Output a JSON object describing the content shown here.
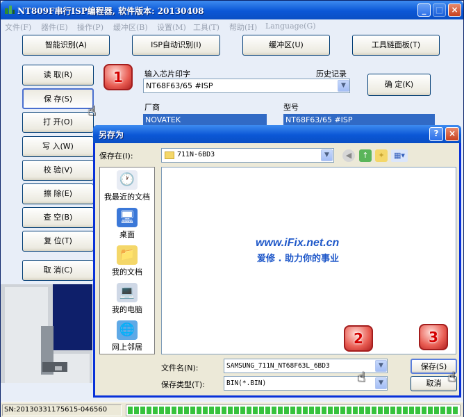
{
  "window": {
    "title": "NT809F串行ISP编程器, 软件版本: 20130408",
    "controls": {
      "minimize": "_",
      "maximize": "□",
      "close": "×"
    }
  },
  "menu": [
    "文件(F)",
    "器件(E)",
    "操作(P)",
    "缓冲区(B)",
    "设置(M)",
    "工具(T)",
    "帮助(H)",
    "Language(G)"
  ],
  "top_buttons": [
    "智能识别(A)",
    "ISP自动识别(I)",
    "缓冲区(U)",
    "工具链面板(T)"
  ],
  "side_buttons": [
    "读 取(R)",
    "保 存(S)",
    "打 开(O)",
    "写 入(W)",
    "校 验(V)",
    "擦 除(E)",
    "查 空(B)",
    "复 位(T)",
    "取 消(C)"
  ],
  "chip": {
    "input_label": "输入芯片印字",
    "history_label": "历史记录",
    "value": "NT68F63/65 #ISP",
    "confirm": "确 定(K)",
    "vendor_label": "厂商",
    "vendor": "NOVATEK",
    "model_label": "型号",
    "model": "NT68F63/65 #ISP"
  },
  "status": {
    "serial": "SN:20130331175615-046560",
    "progress": 1.0
  },
  "dialog": {
    "title": "另存为",
    "help": "?",
    "close": "×",
    "save_in_label": "保存在(I):",
    "save_in_value": "711N-6BD3",
    "places": [
      "我最近的文档",
      "桌面",
      "我的文档",
      "我的电脑",
      "网上邻居"
    ],
    "filename_label": "文件名(N):",
    "filename_value": "SAMSUNG_711N_NT68F63L_6BD3",
    "filetype_label": "保存类型(T):",
    "filetype_value": "BIN(*.BIN)",
    "save": "保存(S)",
    "cancel": "取消"
  },
  "watermark": {
    "url": "www.iFix.net.cn",
    "slogan": "爱修 . 助力你的事业"
  },
  "callouts": [
    "1",
    "2",
    "3"
  ],
  "colors": {
    "titlebar": "#0b57d6",
    "selection": "#316ac5",
    "progress": "#36c23c",
    "callout": "#e85c52"
  }
}
